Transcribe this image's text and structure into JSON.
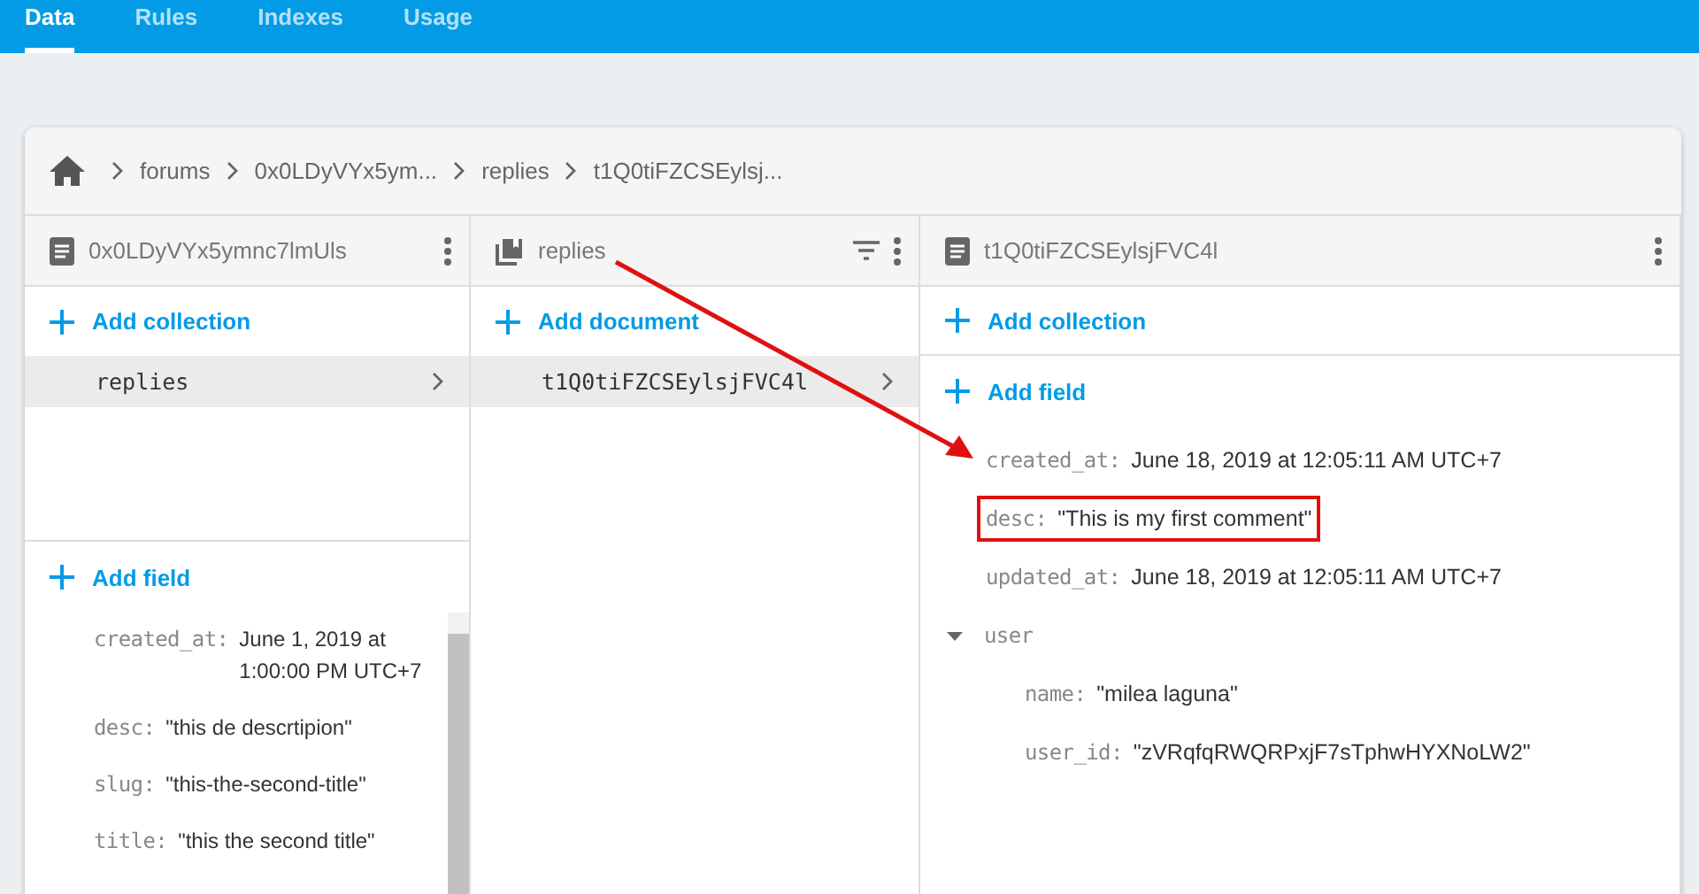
{
  "tabs": [
    {
      "label": "Data",
      "selected": true
    },
    {
      "label": "Rules",
      "selected": false
    },
    {
      "label": "Indexes",
      "selected": false
    },
    {
      "label": "Usage",
      "selected": false
    }
  ],
  "breadcrumb": [
    "forums",
    "0x0LDyVYx5ym...",
    "replies",
    "t1Q0tiFZCSEylsj..."
  ],
  "columns": [
    {
      "kind": "document",
      "title": "0x0LDyVYx5ymnc7lmUls",
      "add_label": "Add collection",
      "items": [
        {
          "label": "replies",
          "selected": true
        }
      ],
      "add_field_label": "Add field",
      "fields": [
        {
          "key": "created_at:",
          "value": "June 1, 2019 at 1:00:00 PM UTC+7",
          "highlighted": false
        },
        {
          "key": "desc:",
          "value": "\"this de descrtipion\"",
          "highlighted": false
        },
        {
          "key": "slug:",
          "value": "\"this-the-second-title\"",
          "highlighted": false
        },
        {
          "key": "title:",
          "value": "\"this the second title\"",
          "highlighted": false
        }
      ]
    },
    {
      "kind": "collection",
      "title": "replies",
      "add_label": "Add document",
      "items": [
        {
          "label": "t1Q0tiFZCSEylsjFVC4l",
          "selected": true
        }
      ]
    },
    {
      "kind": "detail",
      "title": "t1Q0tiFZCSEylsjFVC4l",
      "add_label": "Add collection",
      "add_field_label": "Add field",
      "fields": [
        {
          "key": "created_at:",
          "value": "June 18, 2019 at 12:05:11 AM UTC+7",
          "highlighted": false
        },
        {
          "key": "desc:",
          "value": "\"This is my first comment\"",
          "highlighted": true
        },
        {
          "key": "updated_at:",
          "value": "June 18, 2019 at 12:05:11 AM UTC+7",
          "highlighted": false
        },
        {
          "key": "user",
          "expanded": true,
          "highlighted": false,
          "children": [
            {
              "key": "name:",
              "value": "\"milea laguna\"",
              "highlighted": false
            },
            {
              "key": "user_id:",
              "value": "\"zVRqfqRWQRPxjF7sTphwHYXNoLW2\"",
              "highlighted": false
            }
          ]
        }
      ]
    }
  ]
}
